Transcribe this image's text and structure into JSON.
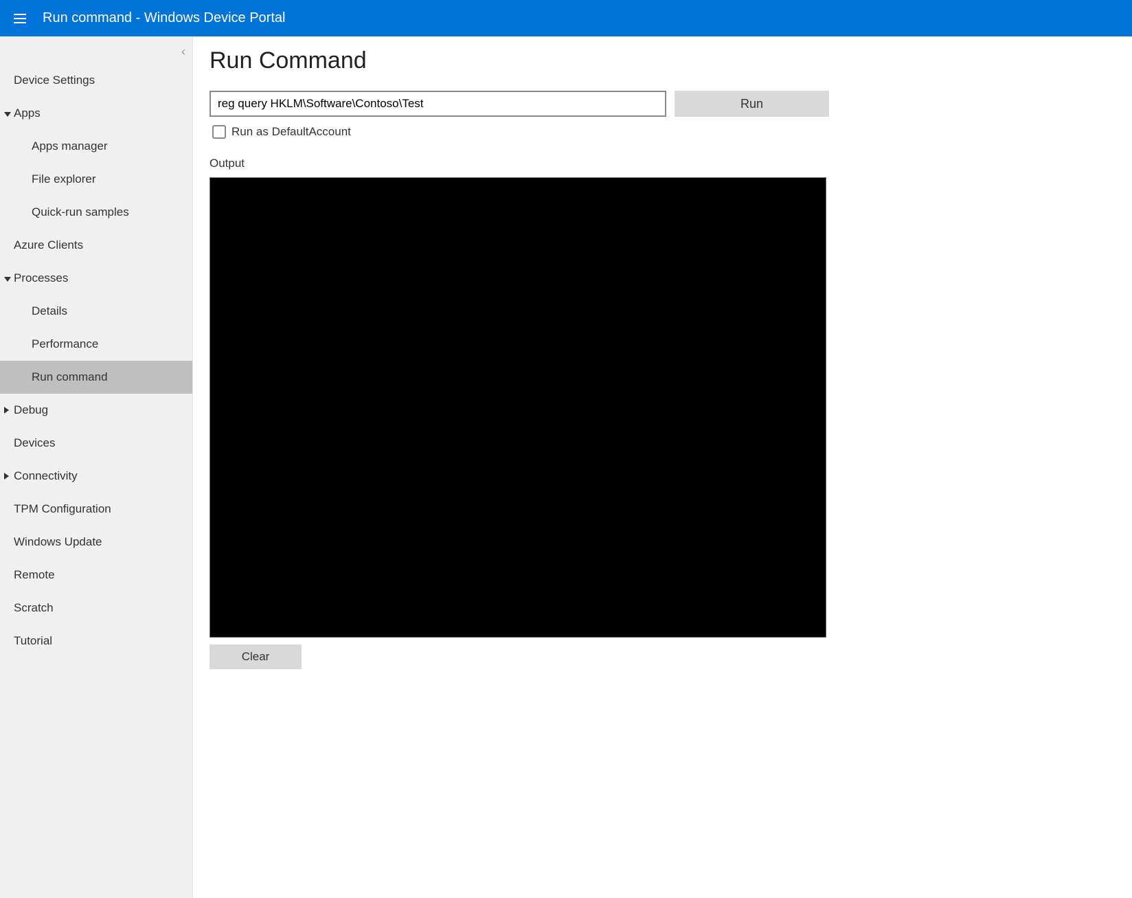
{
  "header": {
    "title": "Run command - Windows Device Portal"
  },
  "sidebar": {
    "items": [
      {
        "label": "Device Settings",
        "level": 0,
        "caret": "none",
        "active": false
      },
      {
        "label": "Apps",
        "level": 0,
        "caret": "open",
        "active": false
      },
      {
        "label": "Apps manager",
        "level": 1,
        "caret": "none",
        "active": false
      },
      {
        "label": "File explorer",
        "level": 1,
        "caret": "none",
        "active": false
      },
      {
        "label": "Quick-run samples",
        "level": 1,
        "caret": "none",
        "active": false
      },
      {
        "label": "Azure Clients",
        "level": 0,
        "caret": "none",
        "active": false
      },
      {
        "label": "Processes",
        "level": 0,
        "caret": "open",
        "active": false
      },
      {
        "label": "Details",
        "level": 1,
        "caret": "none",
        "active": false
      },
      {
        "label": "Performance",
        "level": 1,
        "caret": "none",
        "active": false
      },
      {
        "label": "Run command",
        "level": 1,
        "caret": "none",
        "active": true
      },
      {
        "label": "Debug",
        "level": 0,
        "caret": "closed",
        "active": false
      },
      {
        "label": "Devices",
        "level": 0,
        "caret": "none",
        "active": false
      },
      {
        "label": "Connectivity",
        "level": 0,
        "caret": "closed",
        "active": false
      },
      {
        "label": "TPM Configuration",
        "level": 0,
        "caret": "none",
        "active": false
      },
      {
        "label": "Windows Update",
        "level": 0,
        "caret": "none",
        "active": false
      },
      {
        "label": "Remote",
        "level": 0,
        "caret": "none",
        "active": false
      },
      {
        "label": "Scratch",
        "level": 0,
        "caret": "none",
        "active": false
      },
      {
        "label": "Tutorial",
        "level": 0,
        "caret": "none",
        "active": false
      }
    ]
  },
  "main": {
    "title": "Run Command",
    "command_value": "reg query HKLM\\Software\\Contoso\\Test",
    "run_button": "Run",
    "run_as_default_label": "Run as DefaultAccount",
    "output_label": "Output",
    "output_text": "",
    "clear_button": "Clear"
  }
}
